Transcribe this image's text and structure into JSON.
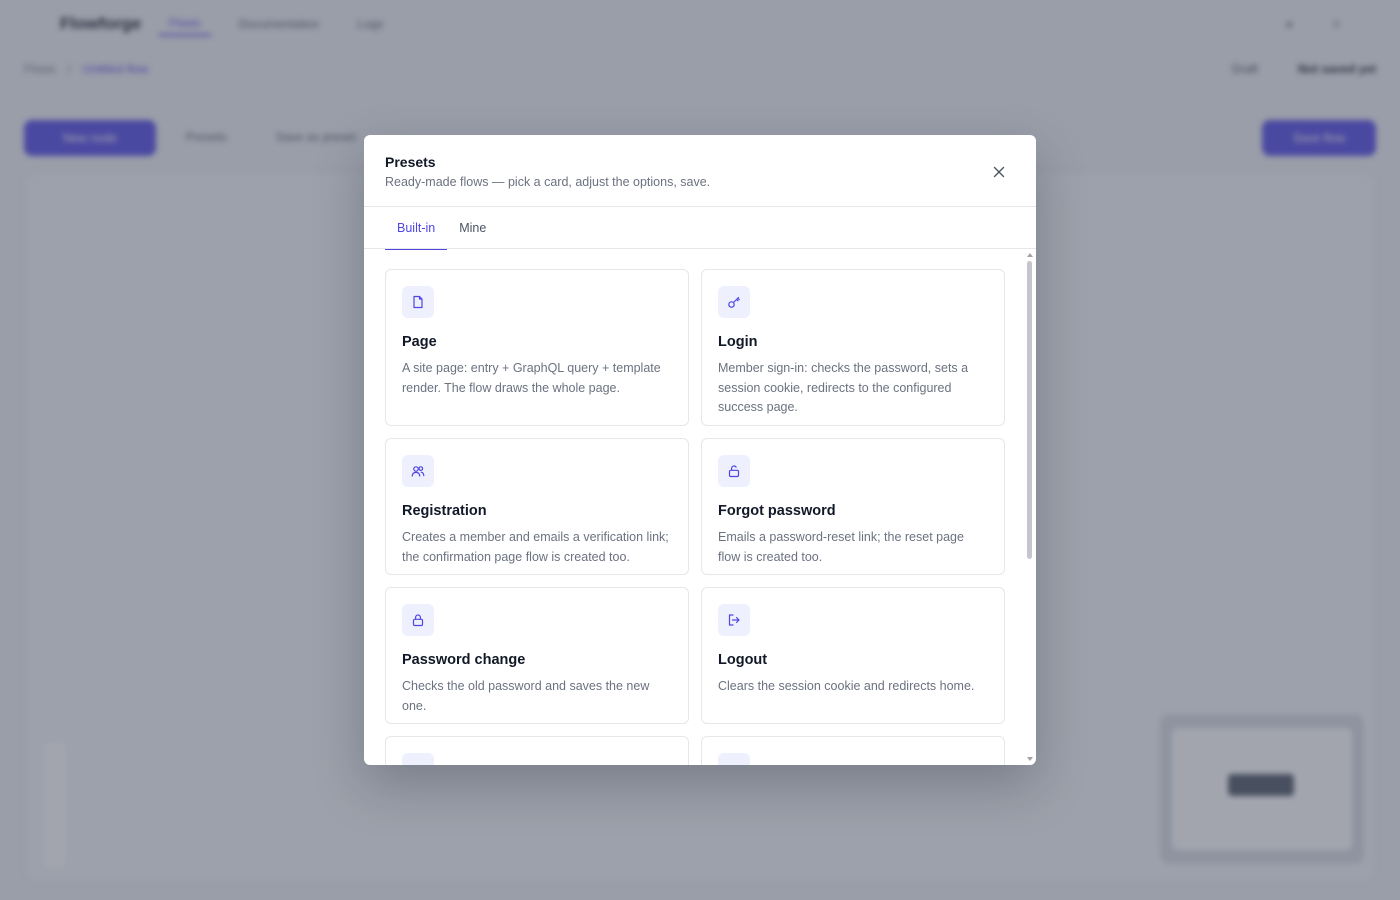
{
  "colors": {
    "accent": "#4f46e5",
    "overlay": "#464c5e",
    "icon_bg": "#eef0fd"
  },
  "background": {
    "brand": "Flowforge",
    "nav": [
      "Flows",
      "Documentation",
      "Logs"
    ],
    "breadcrumb": [
      "Flows",
      "Untitled flow"
    ],
    "crumb_right": [
      "Draft",
      "Not saved yet"
    ],
    "primary_left": "New node",
    "links": [
      "Presets",
      "Save as preset"
    ],
    "primary_right": "Save flow"
  },
  "modal": {
    "title": "Presets",
    "subtitle": "Ready-made flows — pick a card, adjust the options, save.",
    "close_icon": "close-icon",
    "tabs": [
      {
        "label": "Built-in",
        "active": true
      },
      {
        "label": "Mine",
        "active": false
      }
    ],
    "cards": [
      {
        "icon": "file-icon",
        "title": "Page",
        "description": "A site page: entry + GraphQL query + template render. The flow draws the whole page."
      },
      {
        "icon": "key-icon",
        "title": "Login",
        "description": "Member sign-in: checks the password, sets a session cookie, redirects to the configured success page."
      },
      {
        "icon": "users-icon",
        "title": "Registration",
        "description": "Creates a member and emails a verification link; the confirmation page flow is created too."
      },
      {
        "icon": "lock-open-icon",
        "title": "Forgot password",
        "description": "Emails a password-reset link; the reset page flow is created too."
      },
      {
        "icon": "lock-icon",
        "title": "Password change",
        "description": "Checks the old password and saves the new one."
      },
      {
        "icon": "logout-icon",
        "title": "Logout",
        "description": "Clears the session cookie and redirects home."
      },
      {
        "icon": "preset-icon",
        "title": "",
        "description": ""
      },
      {
        "icon": "preset-icon",
        "title": "",
        "description": ""
      }
    ]
  }
}
